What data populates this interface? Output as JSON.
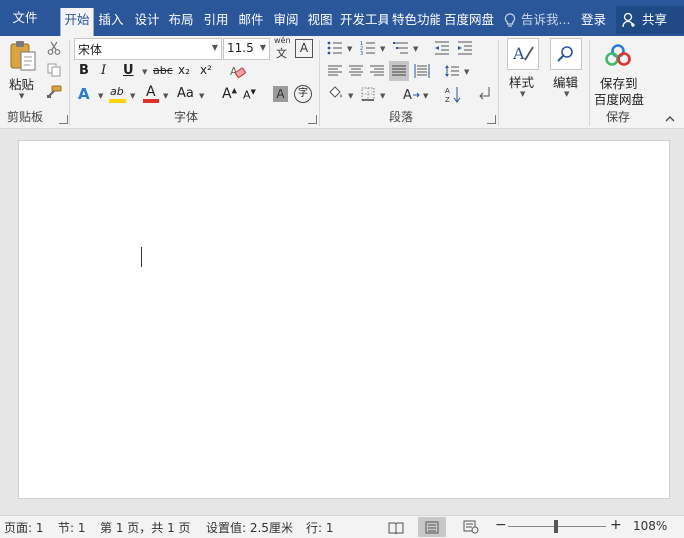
{
  "tabs": {
    "file": "文件",
    "home": "开始",
    "insert": "插入",
    "design": "设计",
    "layout": "布局",
    "references": "引用",
    "mailings": "邮件",
    "review": "审阅",
    "view": "视图",
    "developer": "开发工具",
    "special": "特色功能",
    "baidu": "百度网盘"
  },
  "tell_me": "告诉我...",
  "login": "登录",
  "share": "共享",
  "clipboard": {
    "paste": "粘贴",
    "group_label": "剪贴板"
  },
  "font": {
    "name": "宋体",
    "size": "11.5",
    "group_label": "字体",
    "wen_glyph": "wén",
    "wen_char": "文",
    "border_char": "A",
    "bold": "B",
    "italic": "I",
    "underline": "U",
    "strike": "abc",
    "subscript": "x₂",
    "superscript": "x²",
    "effects": "A",
    "highlight": "ab",
    "color": "A",
    "case": "Aa",
    "grow": "A",
    "shrink": "A",
    "shading": "A",
    "enclose": "字"
  },
  "paragraph": {
    "group_label": "段落"
  },
  "styles": {
    "label": "样式"
  },
  "editing": {
    "label": "编辑"
  },
  "save": {
    "line1": "保存到",
    "line2": "百度网盘",
    "group_label": "保存"
  },
  "status": {
    "page": "页面: 1",
    "section": "节: 1",
    "pages": "第 1 页，共 1 页",
    "setting": "设置值: 2.5厘米",
    "row": "行: 1",
    "zoom": "108%",
    "zoom_minus": "−",
    "zoom_plus": "+"
  },
  "colors": {
    "title_bar": "#2b579a",
    "highlight_bar": "#ffd200",
    "font_color_bar": "#e0302a",
    "ribbon_bg": "#f3f3f3"
  }
}
